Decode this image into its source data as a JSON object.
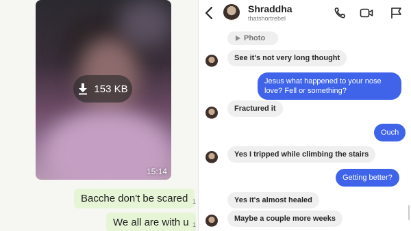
{
  "whatsapp": {
    "media": {
      "size_label": "153 KB",
      "time": "15:14"
    },
    "messages": [
      {
        "text": "Bacche don't be scared",
        "tick": "1"
      },
      {
        "text": "We all are with u",
        "tick": "1"
      }
    ]
  },
  "dm": {
    "header": {
      "name": "Shraddha",
      "username": "thatshortrebel"
    },
    "photo_label": "Photo",
    "messages": [
      {
        "from": "them",
        "text": "See it's not very long thought"
      },
      {
        "from": "me",
        "text": "Jesus what happened to your nose love? Fell or something?"
      },
      {
        "from": "them",
        "text": "Fractured it"
      },
      {
        "from": "me",
        "text": "Ouch"
      },
      {
        "from": "them",
        "text": "Yes I tripped while climbing the stairs"
      },
      {
        "from": "me",
        "text": "Getting better?"
      },
      {
        "from": "them",
        "text": "Yes it's almost healed"
      },
      {
        "from": "them",
        "text": "Maybe a couple more weeks"
      }
    ],
    "colors": {
      "outgoing": "#3f64ea",
      "incoming": "#efefef"
    }
  },
  "icons": [
    "back-arrow-icon",
    "phone-icon",
    "video-icon",
    "flag-icon",
    "download-icon",
    "play-icon"
  ]
}
